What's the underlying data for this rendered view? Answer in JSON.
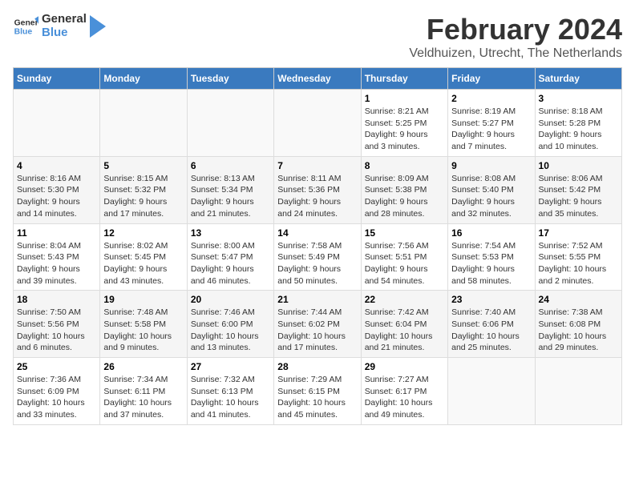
{
  "header": {
    "logo_line1": "General",
    "logo_line2": "Blue",
    "month": "February 2024",
    "location": "Veldhuizen, Utrecht, The Netherlands"
  },
  "weekdays": [
    "Sunday",
    "Monday",
    "Tuesday",
    "Wednesday",
    "Thursday",
    "Friday",
    "Saturday"
  ],
  "weeks": [
    [
      {
        "day": "",
        "info": ""
      },
      {
        "day": "",
        "info": ""
      },
      {
        "day": "",
        "info": ""
      },
      {
        "day": "",
        "info": ""
      },
      {
        "day": "1",
        "info": "Sunrise: 8:21 AM\nSunset: 5:25 PM\nDaylight: 9 hours\nand 3 minutes."
      },
      {
        "day": "2",
        "info": "Sunrise: 8:19 AM\nSunset: 5:27 PM\nDaylight: 9 hours\nand 7 minutes."
      },
      {
        "day": "3",
        "info": "Sunrise: 8:18 AM\nSunset: 5:28 PM\nDaylight: 9 hours\nand 10 minutes."
      }
    ],
    [
      {
        "day": "4",
        "info": "Sunrise: 8:16 AM\nSunset: 5:30 PM\nDaylight: 9 hours\nand 14 minutes."
      },
      {
        "day": "5",
        "info": "Sunrise: 8:15 AM\nSunset: 5:32 PM\nDaylight: 9 hours\nand 17 minutes."
      },
      {
        "day": "6",
        "info": "Sunrise: 8:13 AM\nSunset: 5:34 PM\nDaylight: 9 hours\nand 21 minutes."
      },
      {
        "day": "7",
        "info": "Sunrise: 8:11 AM\nSunset: 5:36 PM\nDaylight: 9 hours\nand 24 minutes."
      },
      {
        "day": "8",
        "info": "Sunrise: 8:09 AM\nSunset: 5:38 PM\nDaylight: 9 hours\nand 28 minutes."
      },
      {
        "day": "9",
        "info": "Sunrise: 8:08 AM\nSunset: 5:40 PM\nDaylight: 9 hours\nand 32 minutes."
      },
      {
        "day": "10",
        "info": "Sunrise: 8:06 AM\nSunset: 5:42 PM\nDaylight: 9 hours\nand 35 minutes."
      }
    ],
    [
      {
        "day": "11",
        "info": "Sunrise: 8:04 AM\nSunset: 5:43 PM\nDaylight: 9 hours\nand 39 minutes."
      },
      {
        "day": "12",
        "info": "Sunrise: 8:02 AM\nSunset: 5:45 PM\nDaylight: 9 hours\nand 43 minutes."
      },
      {
        "day": "13",
        "info": "Sunrise: 8:00 AM\nSunset: 5:47 PM\nDaylight: 9 hours\nand 46 minutes."
      },
      {
        "day": "14",
        "info": "Sunrise: 7:58 AM\nSunset: 5:49 PM\nDaylight: 9 hours\nand 50 minutes."
      },
      {
        "day": "15",
        "info": "Sunrise: 7:56 AM\nSunset: 5:51 PM\nDaylight: 9 hours\nand 54 minutes."
      },
      {
        "day": "16",
        "info": "Sunrise: 7:54 AM\nSunset: 5:53 PM\nDaylight: 9 hours\nand 58 minutes."
      },
      {
        "day": "17",
        "info": "Sunrise: 7:52 AM\nSunset: 5:55 PM\nDaylight: 10 hours\nand 2 minutes."
      }
    ],
    [
      {
        "day": "18",
        "info": "Sunrise: 7:50 AM\nSunset: 5:56 PM\nDaylight: 10 hours\nand 6 minutes."
      },
      {
        "day": "19",
        "info": "Sunrise: 7:48 AM\nSunset: 5:58 PM\nDaylight: 10 hours\nand 9 minutes."
      },
      {
        "day": "20",
        "info": "Sunrise: 7:46 AM\nSunset: 6:00 PM\nDaylight: 10 hours\nand 13 minutes."
      },
      {
        "day": "21",
        "info": "Sunrise: 7:44 AM\nSunset: 6:02 PM\nDaylight: 10 hours\nand 17 minutes."
      },
      {
        "day": "22",
        "info": "Sunrise: 7:42 AM\nSunset: 6:04 PM\nDaylight: 10 hours\nand 21 minutes."
      },
      {
        "day": "23",
        "info": "Sunrise: 7:40 AM\nSunset: 6:06 PM\nDaylight: 10 hours\nand 25 minutes."
      },
      {
        "day": "24",
        "info": "Sunrise: 7:38 AM\nSunset: 6:08 PM\nDaylight: 10 hours\nand 29 minutes."
      }
    ],
    [
      {
        "day": "25",
        "info": "Sunrise: 7:36 AM\nSunset: 6:09 PM\nDaylight: 10 hours\nand 33 minutes."
      },
      {
        "day": "26",
        "info": "Sunrise: 7:34 AM\nSunset: 6:11 PM\nDaylight: 10 hours\nand 37 minutes."
      },
      {
        "day": "27",
        "info": "Sunrise: 7:32 AM\nSunset: 6:13 PM\nDaylight: 10 hours\nand 41 minutes."
      },
      {
        "day": "28",
        "info": "Sunrise: 7:29 AM\nSunset: 6:15 PM\nDaylight: 10 hours\nand 45 minutes."
      },
      {
        "day": "29",
        "info": "Sunrise: 7:27 AM\nSunset: 6:17 PM\nDaylight: 10 hours\nand 49 minutes."
      },
      {
        "day": "",
        "info": ""
      },
      {
        "day": "",
        "info": ""
      }
    ]
  ]
}
